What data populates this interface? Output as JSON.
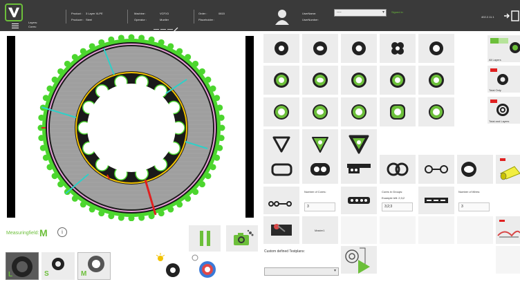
{
  "colors": {
    "topbar": "#3a3a3a",
    "accent_green": "#6cbf3a",
    "ring_green": "#4cd62e",
    "pink": "#e7a0d8",
    "yellow": "#f2c200",
    "red": "#e02020",
    "cyan": "#2ed0c8"
  },
  "header": {
    "menu_icon": "hamburger-icon",
    "layers_label": "Layers:",
    "cores_label": "Cores:",
    "product_label": "Product :",
    "product_value": "3 Layer XLPE",
    "producer_label": "Producer :",
    "producer_value": "Steel",
    "machine_label": "Machine :",
    "machine_value": "VCFX3",
    "operator_label": "Operator :",
    "operator_value": "Mueller",
    "order_label": "Order :",
    "order_value": "0815",
    "placeholder_label": "Placeholder :",
    "username_label": "UserName:",
    "usernumber_label": "UserNumber:",
    "user_select_value": "----",
    "signed_in": "Signed in",
    "version": "402.2.11.1"
  },
  "left": {
    "measuring_label": "Measuringfield:",
    "measuring_value": "M",
    "info_icon": "info-icon",
    "pause_icon": "pause-icon",
    "camera_icon": "camera-icon",
    "thumb_letters": [
      "L",
      "S",
      "M"
    ]
  },
  "right": {
    "all_layers": "All Layers",
    "total_only": "Total Only",
    "total_and_layers": "Total and Layers",
    "number_of_cores": "Number of Cores:",
    "number_of_cores_value": "3",
    "cores_in_groups": "Cores in Groups:",
    "example_left": "Example left: 2;3;2",
    "cores_in_groups_value": "3;2;3",
    "number_of_wires": "Number of Wires:",
    "number_of_wires_value": "3",
    "master_label": "Master1",
    "custom_testplans": "Custom defined Testplans:",
    "custom_select_value": ""
  }
}
